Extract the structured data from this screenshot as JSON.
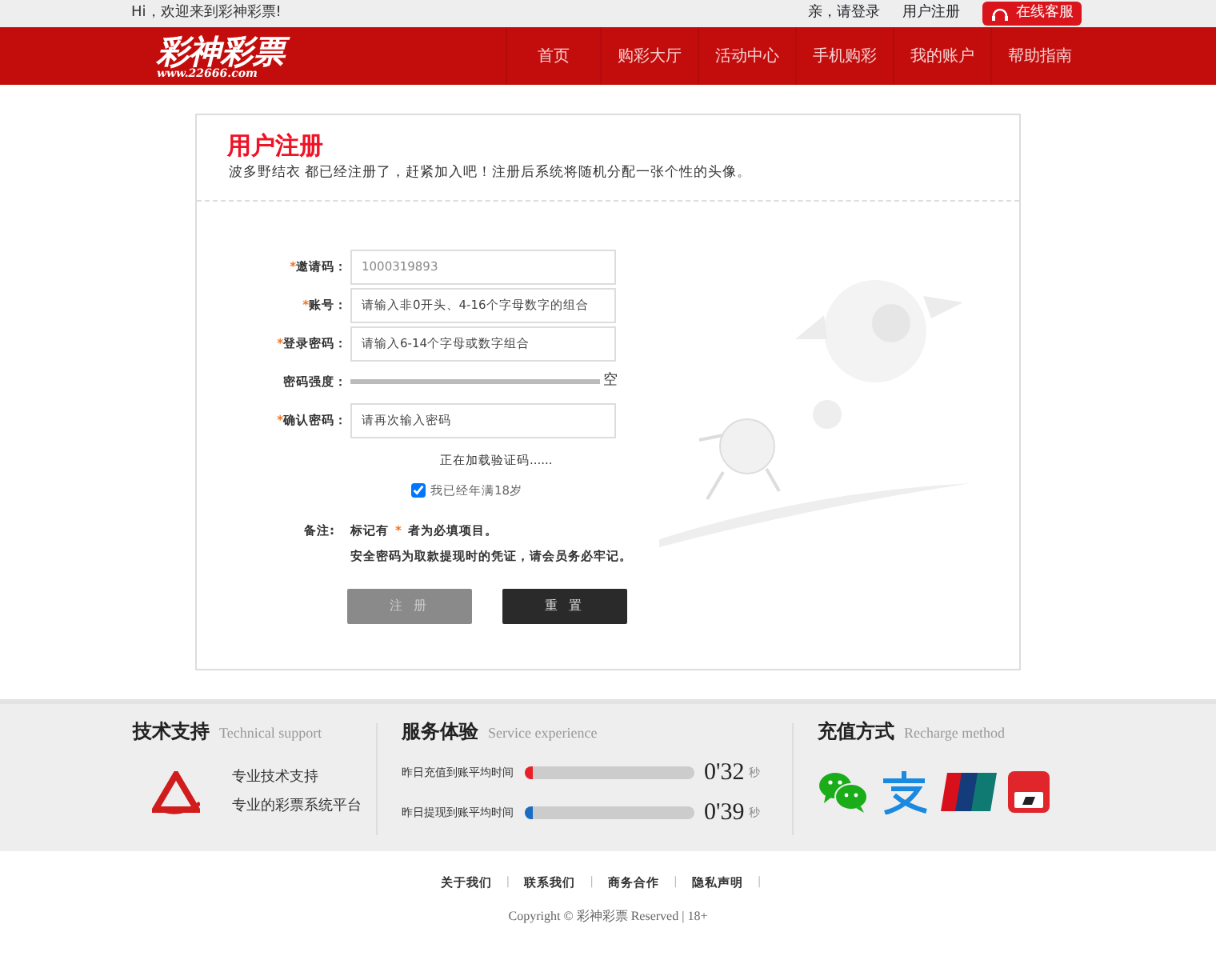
{
  "topbar": {
    "greeting": "Hi，欢迎来到彩神彩票!",
    "links": [
      "亲，请登录",
      "用户注册"
    ],
    "service_button": "在线客服"
  },
  "header": {
    "logo_text": "彩神彩票",
    "logo_url": "www.22666.com",
    "nav": [
      {
        "label": "首页",
        "selected": false
      },
      {
        "label": "购彩大厅",
        "selected": false
      },
      {
        "label": "活动中心",
        "selected": false
      },
      {
        "label": "手机购彩",
        "selected": false
      },
      {
        "label": "我的账户",
        "selected": false
      },
      {
        "label": "帮助指南",
        "selected": false
      }
    ]
  },
  "form": {
    "title": "用户注册",
    "subtitle": "波多野结衣 都已经注册了，赶紧加入吧！注册后系统将随机分配一张个性的头像。",
    "rows": [
      {
        "kind": "input",
        "required": true,
        "label": "邀请码：",
        "value": "1000319893"
      },
      {
        "kind": "input",
        "required": true,
        "label": "账号：",
        "placeholder": "请输入非0开头、4-16个字母数字的组合"
      },
      {
        "kind": "input",
        "required": true,
        "label": "登录密码：",
        "placeholder": "请输入6-14个字母或数字组合"
      },
      {
        "kind": "strength",
        "required": false,
        "label": "密码强度：",
        "level": 0,
        "reading": "空"
      },
      {
        "kind": "input",
        "required": true,
        "label": "确认密码：",
        "placeholder": "请再次输入密码"
      }
    ],
    "captcha_status": "正在加载验证码......",
    "age_check": {
      "label": "我已经年满18岁",
      "checked": true
    },
    "note_label": "备注:",
    "note_lines": [
      "标记有",
      "者为必填项目。",
      "安全密码为取款提现时的凭证，请会员务必牢记。"
    ],
    "note_mark": "*",
    "buttons": [
      {
        "kind": "submit",
        "label": "注 册",
        "disabled": true
      },
      {
        "kind": "reset",
        "label": "重 置",
        "disabled": false
      }
    ]
  },
  "footer": {
    "support": {
      "title": "技术支持",
      "subtitle": "Technical support",
      "lines": [
        "专业技术支持",
        "专业的彩票系统平台"
      ]
    },
    "service": {
      "title": "服务体验",
      "subtitle": "Service experience",
      "meters": [
        {
          "label": "昨日充值到账平均时间",
          "level": 0.03,
          "color": "#e8202a",
          "reading": "0'32",
          "unit": "秒"
        },
        {
          "label": "昨日提现到账平均时间",
          "level": 0.03,
          "color": "#1a6cc4",
          "reading": "0'39",
          "unit": "秒"
        }
      ]
    },
    "recharge": {
      "title": "充值方式",
      "subtitle": "Recharge method",
      "methods": [
        {
          "kind": "wechat"
        },
        {
          "kind": "alipay"
        },
        {
          "kind": "unionpay"
        },
        {
          "kind": "cloudpay"
        }
      ]
    },
    "links": [
      "关于我们",
      "联系我们",
      "商务合作",
      "隐私声明"
    ],
    "separator": "|",
    "copyright": "Copyright © 彩神彩票 Reserved | 18+"
  }
}
